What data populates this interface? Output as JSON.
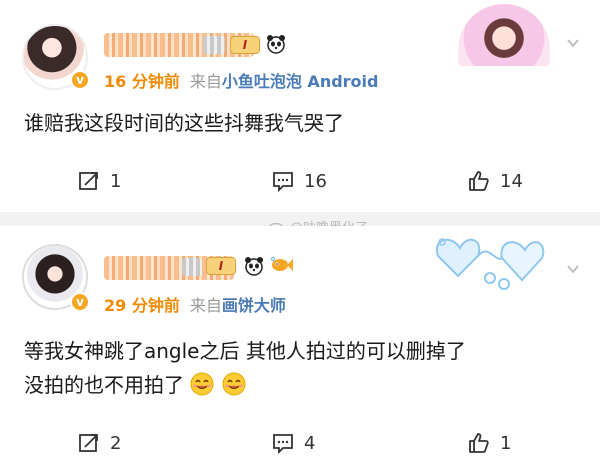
{
  "watermark": {
    "text": "@咕噜黑化了"
  },
  "posts": [
    {
      "level": "I",
      "time": "16 分钟前",
      "from_prefix": "来自",
      "source": "小鱼吐泡泡 Android",
      "content": "谁赔我这段时间的这些抖舞我气哭了",
      "actions": {
        "repost": "1",
        "comment": "16",
        "like": "14"
      },
      "verified_badge": "v"
    },
    {
      "level": "I",
      "time": "29 分钟前",
      "from_prefix": "来自",
      "source": "画饼大师",
      "content_line1": "等我女神跳了angle之后 其他人拍过的可以删掉了",
      "content_line2": "没拍的也不用拍了",
      "actions": {
        "repost": "2",
        "comment": "4",
        "like": "1"
      },
      "verified_badge": "v"
    }
  ],
  "colors": {
    "time": "#f08a00",
    "source": "#4a7bb7",
    "separator": "#f2f2f2"
  }
}
